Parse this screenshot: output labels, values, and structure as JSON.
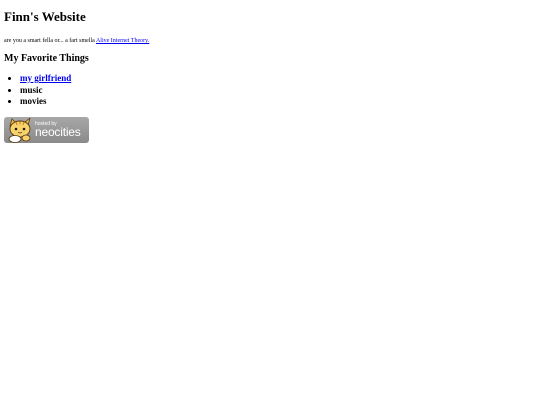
{
  "site": {
    "title": "Finn's Website",
    "tagline_text": "are you a smart fella or... a fart smella ",
    "tagline_link": "Alive Internet Theory."
  },
  "favorites": {
    "heading": "My Favorite Things",
    "items": [
      {
        "label": "my girlfriend",
        "is_link": true
      },
      {
        "label": "music",
        "is_link": false
      },
      {
        "label": "movies",
        "is_link": false
      }
    ]
  },
  "badge": {
    "small_text": "hosted by",
    "brand_text": "neocities",
    "icon": "neocities-cat-icon"
  },
  "colors": {
    "link": "#0000ee",
    "badge_bg": "#999999"
  }
}
